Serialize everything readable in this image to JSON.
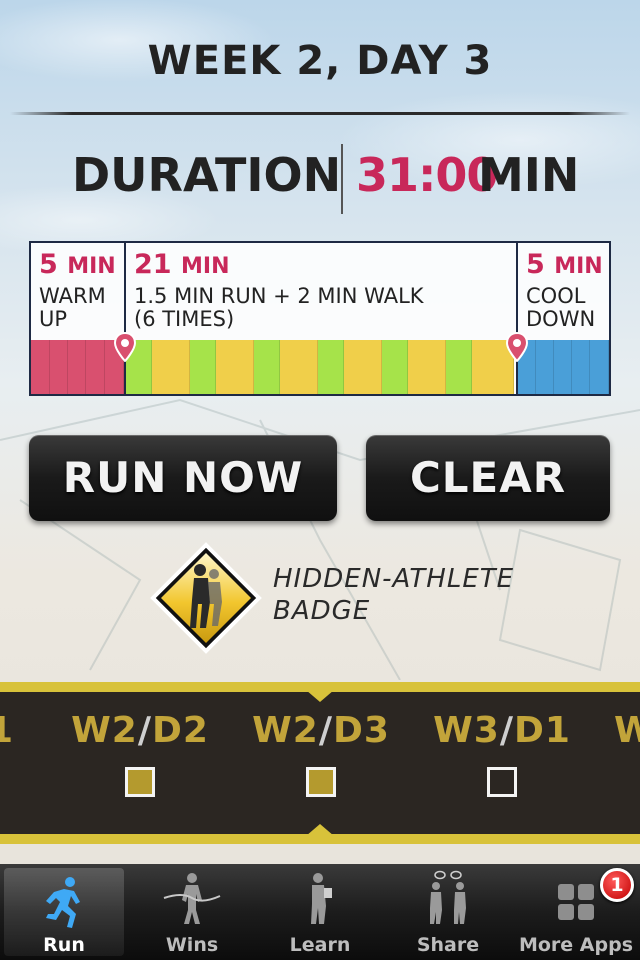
{
  "header": {
    "title": "WEEK 2, DAY 3"
  },
  "duration": {
    "label": "DURATION",
    "value": "31:00",
    "unit": "MIN"
  },
  "plan": {
    "segments": [
      {
        "amount": "5",
        "unit": "MIN",
        "line1": "WARM",
        "line2": "UP"
      },
      {
        "amount": "21",
        "unit": "MIN",
        "line1": "1.5 MIN RUN + 2 MIN WALK",
        "line2": "(6 TIMES)"
      },
      {
        "amount": "5",
        "unit": "MIN",
        "line1": "COOL",
        "line2": "DOWN"
      }
    ],
    "colors": {
      "warmup": "#d9506f",
      "run": "#a6e34a",
      "walk": "#f0cf4a",
      "cooldown": "#4a9fd8",
      "accent": "#c8285a"
    }
  },
  "buttons": {
    "run_now": "RUN NOW",
    "clear": "CLEAR"
  },
  "badge": {
    "line1": "HIDDEN-ATHLETE",
    "line2": "BADGE"
  },
  "schedule": {
    "days": [
      {
        "week": "1",
        "day": "",
        "label_left": "1"
      },
      {
        "week": "W2",
        "day": "D2",
        "done": true
      },
      {
        "week": "W2",
        "day": "D3",
        "done": true,
        "selected": true
      },
      {
        "week": "W3",
        "day": "D1",
        "done": false
      },
      {
        "week": "W",
        "day": ""
      }
    ]
  },
  "tabbar": {
    "tabs": [
      {
        "label": "Run",
        "icon": "runner-icon",
        "active": true
      },
      {
        "label": "Wins",
        "icon": "finish-line-icon"
      },
      {
        "label": "Learn",
        "icon": "reader-icon"
      },
      {
        "label": "Share",
        "icon": "chat-people-icon"
      },
      {
        "label": "More Apps",
        "icon": "apps-grid-icon",
        "badge": "1"
      }
    ]
  }
}
